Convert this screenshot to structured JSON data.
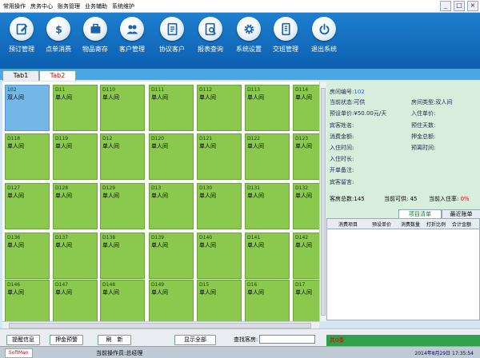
{
  "menu": {
    "items": [
      "常用操作",
      "房务中心",
      "账务管理",
      "业务辅助",
      "系统维护"
    ]
  },
  "toolbar": {
    "buttons": [
      {
        "label": "预订管理",
        "icon": "edit-icon"
      },
      {
        "label": "点单消费",
        "icon": "dollar-icon"
      },
      {
        "label": "物品寄存",
        "icon": "briefcase-icon"
      },
      {
        "label": "客户管理",
        "icon": "users-icon"
      },
      {
        "label": "协议客户",
        "icon": "document-icon"
      },
      {
        "label": "报表查询",
        "icon": "report-search-icon"
      },
      {
        "label": "系统设置",
        "icon": "gear-icon"
      },
      {
        "label": "交班管理",
        "icon": "handover-icon"
      },
      {
        "label": "退出系统",
        "icon": "power-icon"
      }
    ]
  },
  "tabs": {
    "tab1": "Tab1",
    "tab2": "Tab2"
  },
  "rooms": [
    [
      {
        "no": "102",
        "type": "双人间"
      },
      {
        "no": "D11",
        "type": "单人间"
      },
      {
        "no": "D110",
        "type": "单人间"
      },
      {
        "no": "D111",
        "type": "单人间"
      },
      {
        "no": "D112",
        "type": "单人间"
      },
      {
        "no": "D113",
        "type": "单人间"
      },
      {
        "no": "D114",
        "type": "单人间"
      }
    ],
    [
      {
        "no": "D118",
        "type": "单人间"
      },
      {
        "no": "D119",
        "type": "单人间"
      },
      {
        "no": "D12",
        "type": "单人间"
      },
      {
        "no": "D120",
        "type": "单人间"
      },
      {
        "no": "D121",
        "type": "单人间"
      },
      {
        "no": "D122",
        "type": "单人间"
      },
      {
        "no": "D123",
        "type": "单人间"
      }
    ],
    [
      {
        "no": "D127",
        "type": "单人间"
      },
      {
        "no": "D128",
        "type": "单人间"
      },
      {
        "no": "D129",
        "type": "单人间"
      },
      {
        "no": "D13",
        "type": "单人间"
      },
      {
        "no": "D130",
        "type": "单人间"
      },
      {
        "no": "D131",
        "type": "单人间"
      },
      {
        "no": "D132",
        "type": "单人间"
      }
    ],
    [
      {
        "no": "D136",
        "type": "单人间"
      },
      {
        "no": "D137",
        "type": "单人间"
      },
      {
        "no": "D138",
        "type": "单人间"
      },
      {
        "no": "D139",
        "type": "单人间"
      },
      {
        "no": "D140",
        "type": "单人间"
      },
      {
        "no": "D141",
        "type": "单人间"
      },
      {
        "no": "D142",
        "type": "单人间"
      }
    ],
    [
      {
        "no": "D146",
        "type": "单人间"
      },
      {
        "no": "D147",
        "type": "单人间"
      },
      {
        "no": "D148",
        "type": "单人间"
      },
      {
        "no": "D149",
        "type": "单人间"
      },
      {
        "no": "D15",
        "type": "单人间"
      },
      {
        "no": "D16",
        "type": "单人间"
      },
      {
        "no": "D17",
        "type": "单人间"
      }
    ]
  ],
  "detail": {
    "room_no_label": "房间编号:",
    "room_no_value": "102",
    "status_label": "当前状态:",
    "status_value": "可供",
    "room_type_label": "房间类型:",
    "room_type_value": "双人间",
    "preset_price_label": "预设单价:",
    "preset_price_value": "¥50.00元/天",
    "checkin_price_label": "入住单价:",
    "guest_name_label": "宾客姓名:",
    "stay_days_label": "预住天数:",
    "consumption_label": "消费金额:",
    "deposit_label": "押金总额:",
    "checkin_time_label": "入住时间:",
    "expected_leave_label": "预离时间:",
    "stay_duration_label": "入住时长:",
    "remark_label": "开单备注:",
    "guest_message_label": "宾客留言:"
  },
  "stats": {
    "total_label": "客房总数:",
    "total_value": "145",
    "available_label": "当前可供:",
    "available_value": "45",
    "occupancy_label": "当前入住率:",
    "occupancy_value": "0%"
  },
  "panel_tabs": {
    "items_tab": "项目清单",
    "bill_tab": "最近账单"
  },
  "bill_columns": [
    "消费项目",
    "预设单价",
    "消费数量",
    "打折比例",
    "合计金额"
  ],
  "bottom": {
    "remind_button": "提醒信息",
    "deposit_button": "押金预警",
    "refresh_button": "刷　新",
    "show_all_button": "显示全部",
    "search_label": "查找客房:",
    "search_value": ""
  },
  "alert_text": "共0条",
  "status": {
    "left_text": "SoftMan",
    "operator_text": "当前操作员:总经理",
    "time_text": "2014年8月29日 17:35:54"
  }
}
